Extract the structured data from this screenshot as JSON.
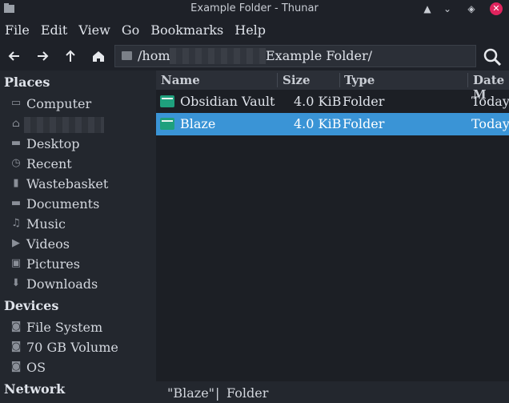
{
  "window": {
    "title": "Example Folder - Thunar"
  },
  "menu": [
    "File",
    "Edit",
    "View",
    "Go",
    "Bookmarks",
    "Help"
  ],
  "path": {
    "prefix": "/home",
    "suffix": "Example Folder/"
  },
  "sidebar": {
    "places_heading": "Places",
    "places": [
      "Computer",
      "",
      "Desktop",
      "Recent",
      "Wastebasket",
      "Documents",
      "Music",
      "Videos",
      "Pictures",
      "Downloads"
    ],
    "devices_heading": "Devices",
    "devices": [
      "File System",
      "70 GB Volume",
      "OS"
    ],
    "network_heading": "Network"
  },
  "columns": [
    "Name",
    "Size",
    "Type",
    "Date M"
  ],
  "files": [
    {
      "name": "Obsidian Vault",
      "size": "4.0 KiB",
      "type": "Folder",
      "date": "Today"
    },
    {
      "name": "Blaze",
      "size": "4.0 KiB",
      "type": "Folder",
      "date": "Today"
    }
  ],
  "status": {
    "selection": "\"Blaze\"",
    "sep": "|",
    "kind": "Folder"
  },
  "colors": {
    "selection": "#3a94d6",
    "folder": "#1fa07d",
    "close": "#e0245e"
  }
}
